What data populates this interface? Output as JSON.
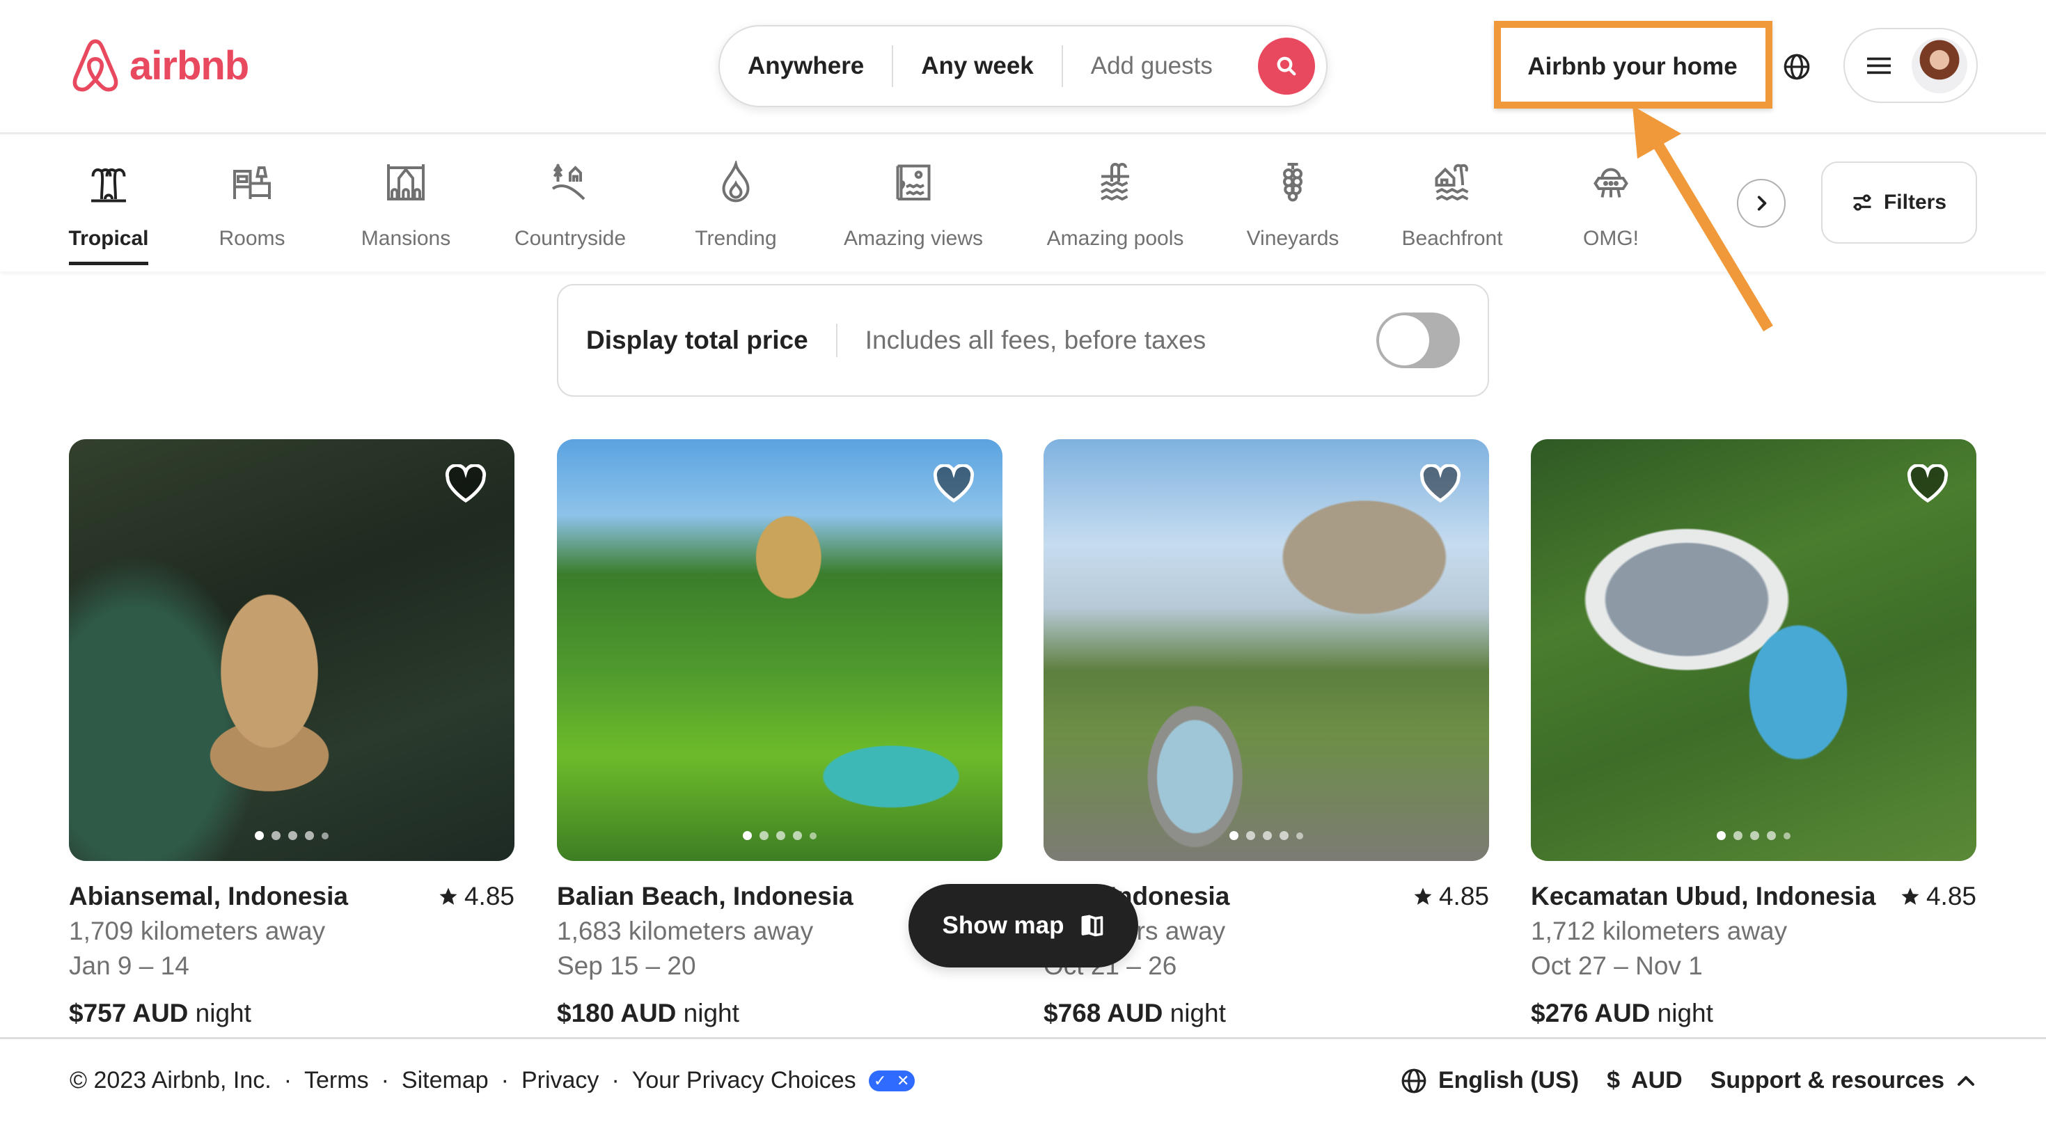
{
  "brand": {
    "name": "airbnb",
    "accent": "#e9495e"
  },
  "search": {
    "where": "Anywhere",
    "when": "Any week",
    "guests_placeholder": "Add guests",
    "search_icon": "search-icon"
  },
  "header": {
    "host_link": "Airbnb your home",
    "globe_icon": "globe-icon",
    "menu_icon": "hamburger-menu-icon",
    "avatar": "user-avatar"
  },
  "annotation": {
    "color": "#f0993a",
    "target": "Airbnb your home"
  },
  "categories": {
    "items": [
      {
        "label": "Tropical",
        "icon": "palm-trees-icon",
        "active": true
      },
      {
        "label": "Rooms",
        "icon": "bed-lamp-icon",
        "active": false
      },
      {
        "label": "Mansions",
        "icon": "mansion-icon",
        "active": false
      },
      {
        "label": "Countryside",
        "icon": "countryside-house-icon",
        "active": false
      },
      {
        "label": "Trending",
        "icon": "flame-icon",
        "active": false
      },
      {
        "label": "Amazing views",
        "icon": "view-window-icon",
        "active": false
      },
      {
        "label": "Amazing pools",
        "icon": "pool-ladder-icon",
        "active": false
      },
      {
        "label": "Vineyards",
        "icon": "grapes-icon",
        "active": false
      },
      {
        "label": "Beachfront",
        "icon": "beach-hut-icon",
        "active": false
      },
      {
        "label": "OMG!",
        "icon": "ufo-icon",
        "active": false
      }
    ],
    "next_icon": "chevron-right-icon",
    "filters_label": "Filters",
    "filters_icon": "sliders-icon"
  },
  "price_toggle": {
    "title": "Display total price",
    "subtitle": "Includes all fees, before taxes",
    "enabled": false
  },
  "listings": [
    {
      "location": "Abiansemal, Indonesia",
      "rating": "4.85",
      "distance": "1,709 kilometers away",
      "dates": "Jan 9 – 14",
      "price": "$757 AUD",
      "price_unit": "night",
      "photo_count": 5,
      "active_photo": 1
    },
    {
      "location": "Balian Beach, Indonesia",
      "rating": "",
      "distance": "1,683 kilometers away",
      "dates": "Sep 15 – 20",
      "price": "$180 AUD",
      "price_unit": "night",
      "photo_count": 5,
      "active_photo": 1
    },
    {
      "location": "...en, Indonesia",
      "rating": "4.85",
      "distance": "...ometers away",
      "dates": "Oct 21 – 26",
      "price": "$768 AUD",
      "price_unit": "night",
      "photo_count": 5,
      "active_photo": 1
    },
    {
      "location": "Kecamatan Ubud, Indonesia",
      "rating": "4.85",
      "distance": "1,712 kilometers away",
      "dates": "Oct 27 – Nov 1",
      "price": "$276 AUD",
      "price_unit": "night",
      "photo_count": 5,
      "active_photo": 1
    }
  ],
  "show_map": {
    "label": "Show map",
    "icon": "map-icon"
  },
  "footer": {
    "copyright": "© 2023 Airbnb, Inc.",
    "links": [
      "Terms",
      "Sitemap",
      "Privacy",
      "Your Privacy Choices"
    ],
    "separator": "·",
    "language": "English (US)",
    "currency_symbol": "$",
    "currency": "AUD",
    "support": "Support & resources"
  }
}
